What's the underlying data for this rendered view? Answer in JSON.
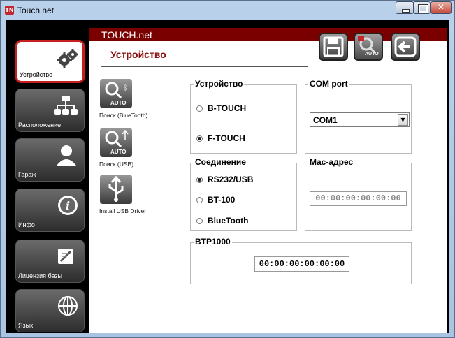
{
  "window": {
    "title": "Touch.net",
    "app_icon": "TN"
  },
  "header": {
    "app_title": "TOUCH.net",
    "page_title": "Устройство",
    "toolbar": {
      "auto_badge": "AUTO"
    }
  },
  "sidebar": {
    "items": [
      {
        "label": "Устройство",
        "icon": "gears-icon",
        "active": true
      },
      {
        "label": "Расположение",
        "icon": "hierarchy-icon",
        "active": false
      },
      {
        "label": "Гараж",
        "icon": "person-icon",
        "active": false
      },
      {
        "label": "Инфо",
        "icon": "info-icon",
        "active": false
      },
      {
        "label": "Лицензия базы",
        "icon": "license-icon",
        "active": false
      },
      {
        "label": "Язык",
        "icon": "globe-icon",
        "active": false
      }
    ]
  },
  "actions": [
    {
      "label": "Поиск (BlueTooth)",
      "badge": "AUTO"
    },
    {
      "label": "Поиск (USB)",
      "badge": "AUTO"
    },
    {
      "label": "Install USB Driver"
    }
  ],
  "device_group": {
    "legend": "Устройство",
    "options": [
      "B-TOUCH",
      "F-TOUCH"
    ],
    "selected": "F-TOUCH"
  },
  "com_group": {
    "legend": "COM port",
    "value": "COM1"
  },
  "connection_group": {
    "legend": "Соединение",
    "options": [
      "RS232/USB",
      "BT-100",
      "BlueTooth"
    ],
    "selected": "RS232/USB"
  },
  "mac_group": {
    "legend": "Mac-адрес",
    "value": "00:00:00:00:00:00"
  },
  "btp_group": {
    "legend": "BTP1000",
    "value": "00:00:00:00:00:00"
  },
  "colors": {
    "accent": "#7a0000",
    "active_border": "#c71f1f",
    "title_color": "#8b1010"
  }
}
